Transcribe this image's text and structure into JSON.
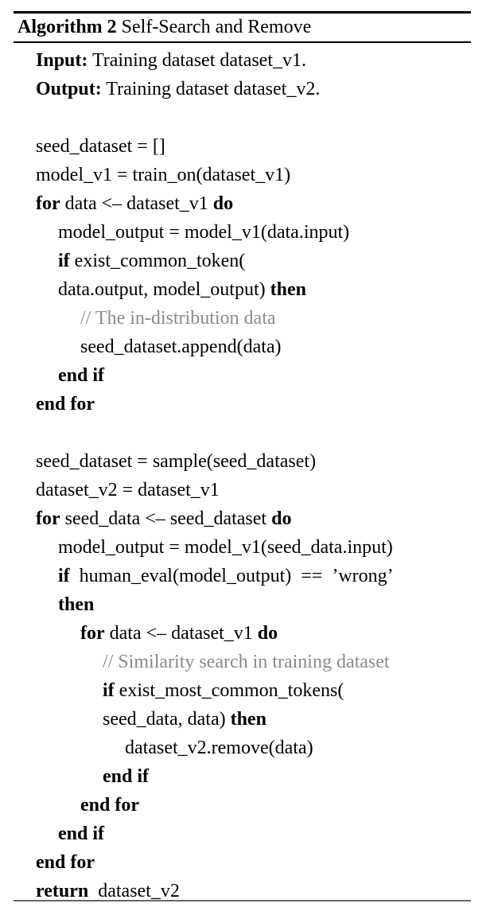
{
  "header": {
    "label": "Algorithm 2",
    "title": "Self-Search and Remove"
  },
  "io": {
    "input_label": "Input:",
    "input_text": " Training dataset dataset_v1.",
    "output_label": "Output:",
    "output_text": " Training dataset dataset_v2."
  },
  "colors": {
    "text": "#000000",
    "comment": "#8a8a8a",
    "rule": "#000000",
    "rule_bottom": "#676767",
    "background": "#ffffff"
  },
  "lines": [
    {
      "indent": 1,
      "type": "blank",
      "text": ""
    },
    {
      "indent": 1,
      "type": "code",
      "text": "seed_dataset = []"
    },
    {
      "indent": 1,
      "type": "code",
      "text": "model_v1 = train_on(dataset_v1)"
    },
    {
      "indent": 1,
      "type": "code",
      "kw_pre": "for",
      "text": " data <– dataset_v1 ",
      "kw_post": "do"
    },
    {
      "indent": 2,
      "type": "code",
      "text": "model_output = model_v1(data.input)"
    },
    {
      "indent": 2,
      "type": "code",
      "kw_pre": "if",
      "text": " exist_common_token("
    },
    {
      "indent": 2,
      "type": "code",
      "text": "data.output, model_output) ",
      "kw_post": "then"
    },
    {
      "indent": 3,
      "type": "comment",
      "text": "// The in-distribution data"
    },
    {
      "indent": 3,
      "type": "code",
      "text": "seed_dataset.append(data)"
    },
    {
      "indent": 2,
      "type": "code",
      "kw_pre": "end if"
    },
    {
      "indent": 1,
      "type": "code",
      "kw_pre": "end for"
    },
    {
      "indent": 1,
      "type": "blank",
      "text": ""
    },
    {
      "indent": 1,
      "type": "code",
      "text": "seed_dataset = sample(seed_dataset)"
    },
    {
      "indent": 1,
      "type": "code",
      "text": "dataset_v2 = dataset_v1"
    },
    {
      "indent": 1,
      "type": "code",
      "kw_pre": "for",
      "text": " seed_data <– seed_dataset ",
      "kw_post": "do"
    },
    {
      "indent": 2,
      "type": "code",
      "text": "model_output = model_v1(seed_data.input)"
    },
    {
      "indent": 2,
      "type": "code",
      "kw_pre": "if",
      "text": "  human_eval(model_output)  ==  ’wrong’"
    },
    {
      "indent": 2,
      "type": "code",
      "kw_pre": "then"
    },
    {
      "indent": 3,
      "type": "code",
      "kw_pre": "for",
      "text": " data <– dataset_v1 ",
      "kw_post": "do"
    },
    {
      "indent": 4,
      "type": "comment",
      "text": "// Similarity search in training dataset"
    },
    {
      "indent": 4,
      "type": "code",
      "kw_pre": "if",
      "text": " exist_most_common_tokens("
    },
    {
      "indent": 4,
      "type": "code",
      "text": "seed_data, data) ",
      "kw_post": "then"
    },
    {
      "indent": 5,
      "type": "code",
      "text": "dataset_v2.remove(data)"
    },
    {
      "indent": 4,
      "type": "code",
      "kw_pre": "end if"
    },
    {
      "indent": 3,
      "type": "code",
      "kw_pre": "end for"
    },
    {
      "indent": 2,
      "type": "code",
      "kw_pre": "end if"
    },
    {
      "indent": 1,
      "type": "code",
      "kw_pre": "end for"
    },
    {
      "indent": 1,
      "type": "code",
      "kw_pre": "return",
      "text": "  dataset_v2"
    }
  ]
}
